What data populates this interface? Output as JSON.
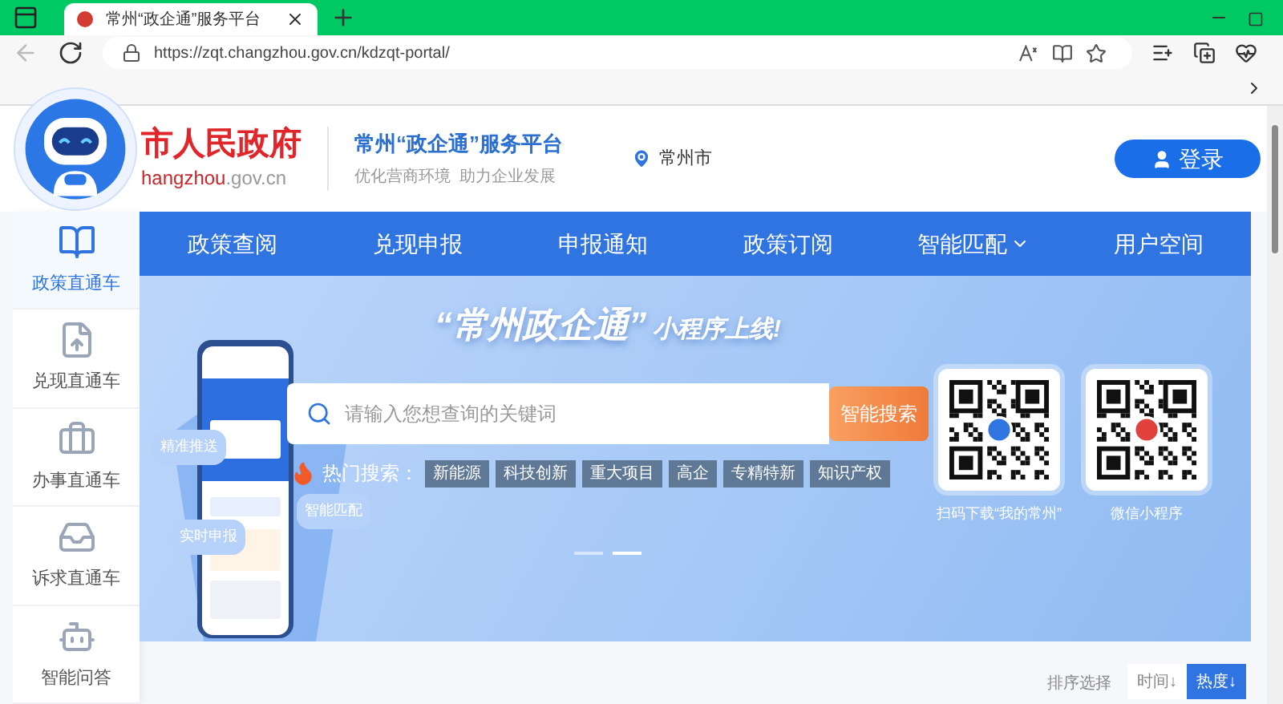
{
  "browser": {
    "tab": {
      "title": "常州“政企通”服务平台",
      "selected": true
    },
    "url": "https://zqt.changzhou.gov.cn/kdzqt-portal/"
  },
  "header": {
    "site_name": "市人民政府",
    "site_domain": "**hangzhou**.gov.cn",
    "platform_title": "常州“政企通”服务平台",
    "platform_slogan": "优化营商环境  助力企业发展",
    "location": "常州市",
    "login": "登录"
  },
  "nav": [
    {
      "label": "政策查阅",
      "dropdown": false
    },
    {
      "label": "兑现申报",
      "dropdown": false
    },
    {
      "label": "申报通知",
      "dropdown": false
    },
    {
      "label": "政策订阅",
      "dropdown": false
    },
    {
      "label": "智能匹配",
      "dropdown": true
    },
    {
      "label": "用户空间",
      "dropdown": false
    }
  ],
  "sidebar": [
    {
      "label": "政策直通车",
      "kind": "book",
      "selected": true
    },
    {
      "label": "兑现直通车",
      "kind": "file",
      "selected": false
    },
    {
      "label": "办事直通车",
      "kind": "briefcase",
      "selected": false
    },
    {
      "label": "诉求直通车",
      "kind": "inbox",
      "selected": false
    },
    {
      "label": "智能问答",
      "kind": "bot",
      "selected": false
    }
  ],
  "banner": {
    "headline": "“常州政企通”",
    "headline_suffix": "小程序上线!",
    "bubbles": [
      "精准推送",
      "实时申报",
      "智能匹配"
    ],
    "search": {
      "placeholder": "请输入您想查询的关键词",
      "button": "智能搜索"
    },
    "hot_label": "热门搜索：",
    "hot_tags": [
      "新能源",
      "科技创新",
      "重大项目",
      "高企",
      "专精特新",
      "知识产权"
    ],
    "qr_codes": [
      {
        "caption": "扫码下载“我的常州”"
      },
      {
        "caption": "微信小程序"
      }
    ],
    "slides": [
      {
        "selected": false
      },
      {
        "selected": true
      }
    ]
  },
  "sort": {
    "label": "排序选择",
    "options": [
      {
        "label": "时间↓",
        "selected": false
      },
      {
        "label": "热度↓",
        "selected": true
      }
    ]
  }
}
